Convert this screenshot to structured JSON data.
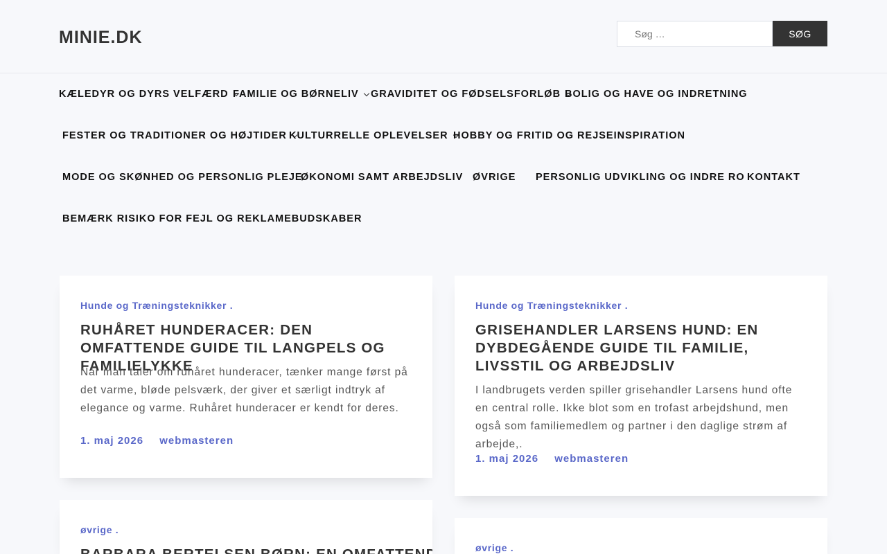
{
  "site": {
    "title": "MINIE.DK"
  },
  "search": {
    "placeholder": "Søg …",
    "button_label": "SØG"
  },
  "nav": {
    "items": [
      {
        "label": "KÆLEDYR OG DYRS VELFÆRD",
        "has_submenu": true
      },
      {
        "label": "FAMILIE OG BØRNELIV",
        "has_submenu": true
      },
      {
        "label": "GRAVIDITET OG FØDSELSFORLØB",
        "has_submenu": true
      },
      {
        "label": "BOLIG OG HAVE OG INDRETNING",
        "has_submenu": false
      },
      {
        "label": "FESTER OG TRADITIONER OG HØJTIDER",
        "has_submenu": true
      },
      {
        "label": "KULTURRELLE OPLEVELSER",
        "has_submenu": true
      },
      {
        "label": "HOBBY OG FRITID OG REJSEINSPIRATION",
        "has_submenu": false
      },
      {
        "label": "MODE OG SKØNHED OG PERSONLIG PLEJE",
        "has_submenu": false
      },
      {
        "label": "ØKONOMI SAMT ARBEJDSLIV",
        "has_submenu": false
      },
      {
        "label": "ØVRIGE",
        "has_submenu": false
      },
      {
        "label": "PERSONLIG UDVIKLING OG INDRE RO",
        "has_submenu": false
      },
      {
        "label": "KONTAKT",
        "has_submenu": false
      },
      {
        "label": "BEMÆRK RISIKO FOR FEJL OG REKLAMEBUDSKABER",
        "has_submenu": false
      }
    ]
  },
  "posts": [
    {
      "category": "Hunde og Træningsteknikker .",
      "title": "RUHÅRET HUNDERACER: DEN OMFATTENDE GUIDE TIL LANGPELS OG FAMILIELYKKE",
      "excerpt": "Når man taler om ruhåret hunderacer, tænker mange først på det varme, bløde pelsværk, der giver et særligt indtryk af elegance og varme. Ruhåret hunderacer er kendt for deres.",
      "date": "1. maj 2026",
      "author": "webmasteren"
    },
    {
      "category": "Hunde og Træningsteknikker .",
      "title": "GRISEHANDLER LARSENS HUND: EN DYBDEGÅENDE GUIDE TIL FAMILIE, LIVSSTIL OG ARBEJDSLIV",
      "excerpt": "I landbrugets verden spiller grisehandler Larsens hund ofte en central rolle. Ikke blot som en trofast arbejdshund, men også som familiemedlem og partner i den daglige strøm af arbejde,.",
      "date": "1. maj 2026",
      "author": "webmasteren"
    },
    {
      "category": "øvrige .",
      "title": "BARBARA BERTELSEN BØRN: EN OMFATTENDE"
    },
    {
      "category": "øvrige ."
    }
  ],
  "colors": {
    "accent": "#5a68c9",
    "dark": "#333333",
    "background": "#f7f8fb"
  }
}
